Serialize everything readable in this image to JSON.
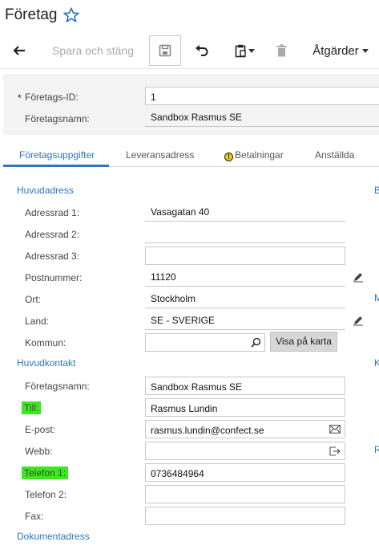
{
  "page": {
    "title": "Företag"
  },
  "toolbar": {
    "save_close_label": "Spara och stäng",
    "actions_label": "Åtgärder"
  },
  "header": {
    "company_id_label": "Företags-ID:",
    "company_id_value": "1",
    "company_name_label": "Företagsnamn:",
    "company_name_value": "Sandbox Rasmus SE",
    "required_mark": "*"
  },
  "tabs": [
    {
      "label": "Företagsuppgifter"
    },
    {
      "label": "Leveransadress"
    },
    {
      "label": "Betalningar",
      "icon": "warning-icon"
    },
    {
      "label": "Anställda"
    }
  ],
  "main_address": {
    "section_title": "Huvudadress",
    "address1_label": "Adressrad 1:",
    "address1_value": "Vasagatan 40",
    "address2_label": "Adressrad 2:",
    "address2_value": "",
    "address3_label": "Adressrad 3:",
    "address3_value": "",
    "postal_label": "Postnummer:",
    "postal_value": "11120",
    "city_label": "Ort:",
    "city_value": "Stockholm",
    "country_label": "Land:",
    "country_value": "SE - SVERIGE",
    "municipality_label": "Kommun:",
    "municipality_value": "",
    "map_button_label": "Visa på karta"
  },
  "main_contact": {
    "section_title": "Huvudkontakt",
    "company_name_label": "Företagsnamn:",
    "company_name_value": "Sandbox Rasmus SE",
    "to_label": "Till:",
    "to_value": "Rasmus Lundin",
    "email_label": "E-post:",
    "email_value": "rasmus.lundin@confect.se",
    "web_label": "Webb:",
    "web_value": "",
    "phone1_label": "Telefon 1:",
    "phone1_value": "0736484964",
    "phone2_label": "Telefon 2:",
    "phone2_value": "",
    "fax_label": "Fax:",
    "fax_value": ""
  },
  "document_address": {
    "section_title": "Dokumentadress"
  },
  "right_column_letters": [
    "B",
    "M",
    "K",
    "R"
  ],
  "colors": {
    "accent": "#2d75c0",
    "highlight": "#3ee621",
    "warning": "#f4d100"
  }
}
